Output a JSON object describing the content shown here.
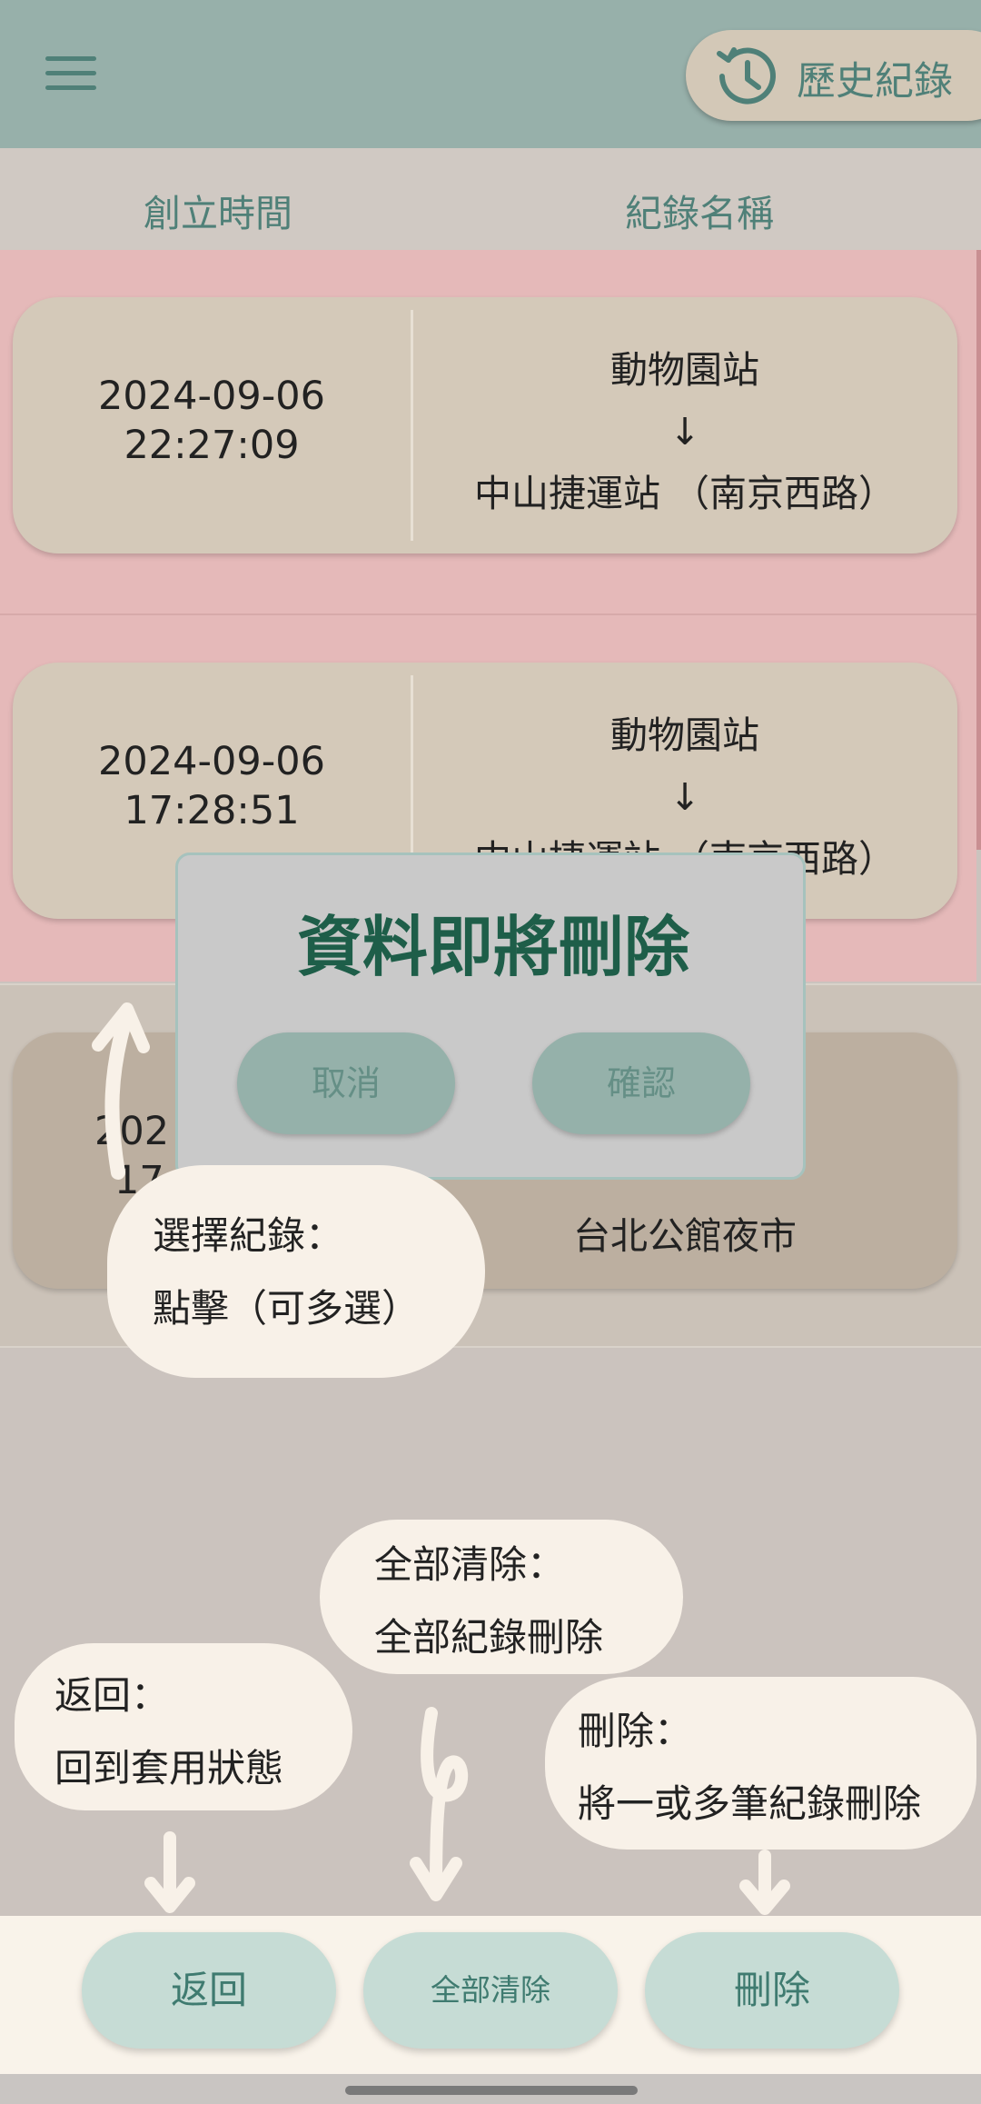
{
  "app_bar": {
    "history_label": "歷史紀錄"
  },
  "columns": {
    "created_time": "創立時間",
    "record_name": "紀錄名稱"
  },
  "records": [
    {
      "date": "2024-09-06",
      "time": "22:27:09",
      "from": "動物園站",
      "arrow": "↓",
      "to": "中山捷運站 （南京西路）",
      "selected": true
    },
    {
      "date": "2024-09-06",
      "time": "17:28:51",
      "from": "動物園站",
      "arrow": "↓",
      "to": "中山捷運站 （南京西路）",
      "selected": true
    },
    {
      "date_partial": "202",
      "time_partial": "17:",
      "to": "台北公館夜市",
      "selected": false
    }
  ],
  "dialog": {
    "title": "資料即將刪除",
    "cancel_label": "取消",
    "confirm_label": "確認"
  },
  "annotations": {
    "select": {
      "line1": "選擇紀錄：",
      "line2": "點擊（可多選）"
    },
    "clear_all": {
      "line1": "全部清除：",
      "line2": "全部紀錄刪除"
    },
    "back": {
      "line1": "返回：",
      "line2": "回到套用狀態"
    },
    "delete": {
      "line1": "刪除：",
      "line2": "將一或多筆紀錄刪除"
    }
  },
  "bottom_bar": {
    "back_label": "返回",
    "clear_all_label": "全部清除",
    "delete_label": "刪除"
  },
  "colors": {
    "accent": "#4f8078",
    "selected_row": "#e5b9b9",
    "dialog_title": "#1e5e49"
  }
}
